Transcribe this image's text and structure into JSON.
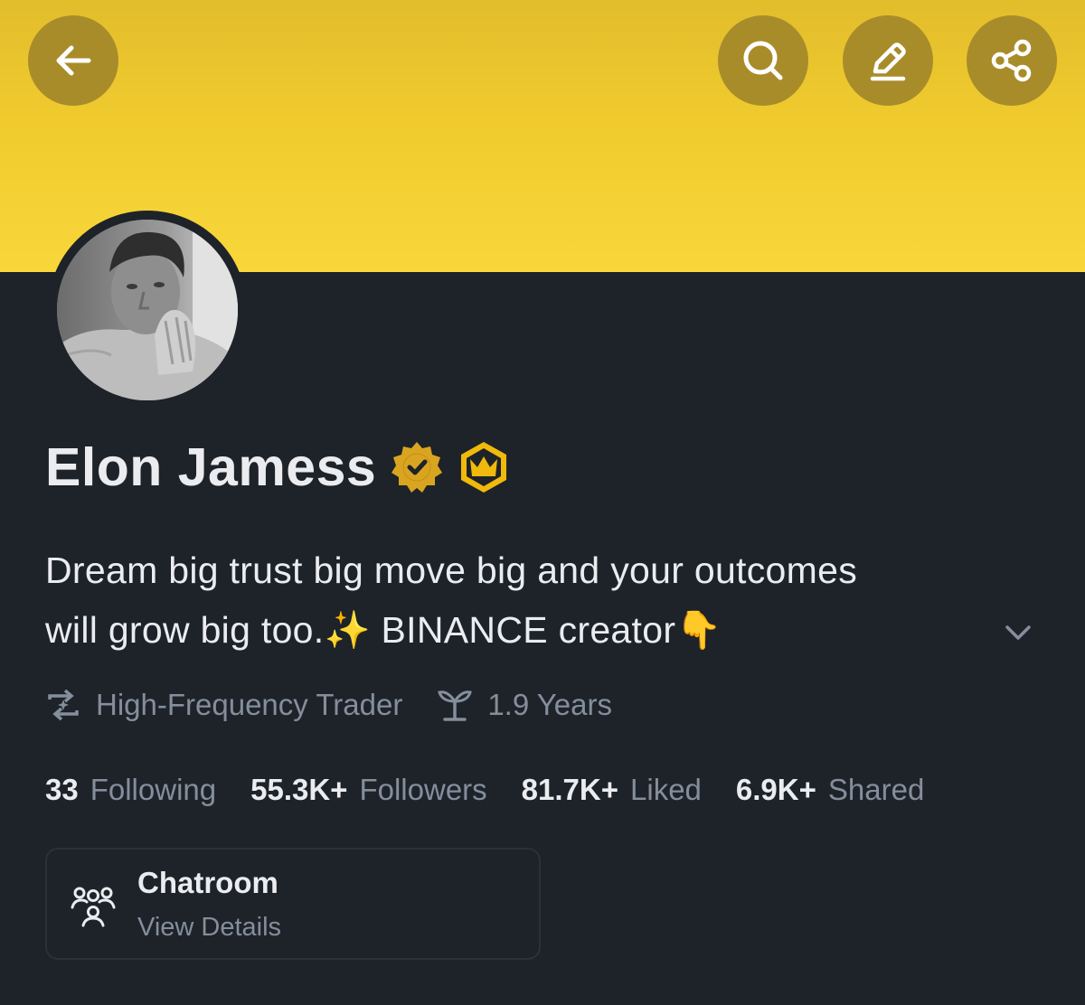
{
  "header": {
    "icons": [
      "back-arrow-icon",
      "search-icon",
      "edit-icon",
      "share-icon"
    ]
  },
  "profile": {
    "name": "Elon Jamess",
    "badges": [
      "verified-badge-icon",
      "crown-badge-icon"
    ],
    "bio_line1": "Dream big trust big move big and your outcomes",
    "bio_line2": "will grow big too.✨ BINANCE creator👇",
    "trader_type": "High-Frequency Trader",
    "tenure": "1.9 Years"
  },
  "stats": [
    {
      "value": "33",
      "label": "Following"
    },
    {
      "value": "55.3K+",
      "label": "Followers"
    },
    {
      "value": "81.7K+",
      "label": "Liked"
    },
    {
      "value": "6.9K+",
      "label": "Shared"
    }
  ],
  "chatroom": {
    "title": "Chatroom",
    "subtitle": "View Details"
  },
  "colors": {
    "banner": "#f0cb2e",
    "background": "#1e2329",
    "button_bg": "#a98c2a",
    "primary_text": "#eaecef",
    "secondary_text": "#848e9c",
    "badge_gold": "#f0b90b"
  }
}
